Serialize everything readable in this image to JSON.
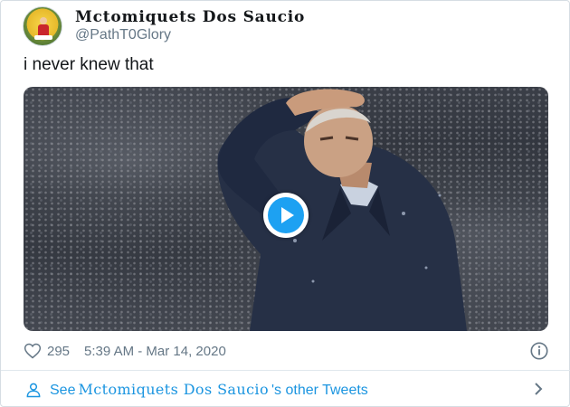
{
  "tweet": {
    "display_name": "Mctomiquets Dos Saucio",
    "handle": "@PathT0Glory",
    "text": "i never knew that",
    "likes": "295",
    "timestamp": "5:39 AM - Mar 14, 2020"
  },
  "footer": {
    "prefix": "See",
    "name": "Mctomiquets Dos Saucio",
    "suffix": "'s other Tweets"
  },
  "icons": {
    "avatar": "avatar-icon",
    "play": "play-icon",
    "like": "heart-icon",
    "info": "info-icon",
    "profile": "person-icon",
    "more": "chevron-right-icon"
  },
  "colors": {
    "accent": "#1da1f2",
    "link": "#1b95e0",
    "secondary_text": "#657786"
  }
}
